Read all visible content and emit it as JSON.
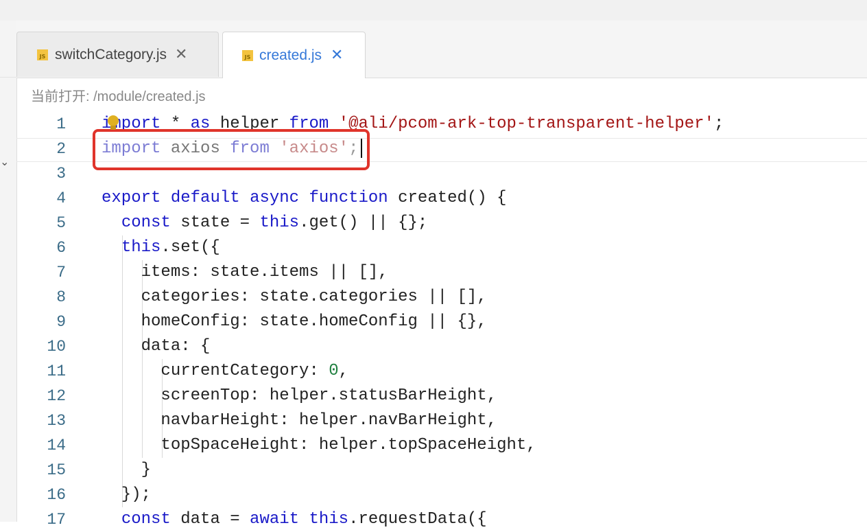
{
  "tabs": [
    {
      "label": "switchCategory.js",
      "icon": "js-file-icon",
      "active": false,
      "icon_text": "JS"
    },
    {
      "label": "created.js",
      "icon": "js-file-icon",
      "active": true,
      "icon_text": "JS"
    }
  ],
  "close_glyph": "✕",
  "path_label": "当前打开: /module/created.js",
  "colors": {
    "accent": "#3578d8",
    "highlight": "#e0342b",
    "keyword": "#1a1ac8",
    "string": "#a31515",
    "number": "#208040"
  },
  "editor": {
    "line_numbers": [
      "1",
      "2",
      "3",
      "4",
      "5",
      "6",
      "7",
      "8",
      "9",
      "10",
      "11",
      "12",
      "13",
      "14",
      "15",
      "16",
      "17"
    ],
    "lines": [
      "import * as helper from '@ali/pcom-ark-top-transparent-helper';",
      "import axios from 'axios';",
      "",
      "export default async function created() {",
      "  const state = this.get() || {};",
      "  this.set({",
      "    items: state.items || [],",
      "    categories: state.categories || [],",
      "    homeConfig: state.homeConfig || {},",
      "    data: {",
      "      currentCategory: 0,",
      "      screenTop: helper.statusBarHeight,",
      "      navbarHeight: helper.navBarHeight,",
      "      topSpaceHeight: helper.topSpaceHeight,",
      "    }",
      "  });",
      "  const data = await this.requestData({"
    ]
  },
  "lightbulb_icon": "lightbulb-icon"
}
